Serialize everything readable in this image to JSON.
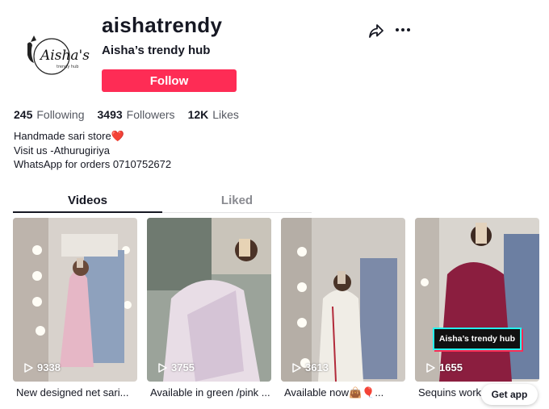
{
  "profile": {
    "username": "aishatrendy",
    "display_name": "Aisha’s trendy hub",
    "follow_label": "Follow",
    "avatar_text": "Aisha's"
  },
  "stats": {
    "following_count": "245",
    "following_label": "Following",
    "followers_count": "3493",
    "followers_label": "Followers",
    "likes_count": "12K",
    "likes_label": "Likes"
  },
  "bio": {
    "line1": "Handmade sari store❤️",
    "line2": "Visit us -Athurugiriya",
    "line3": "WhatsApp for orders 0710752672"
  },
  "tabs": [
    {
      "label": "Videos",
      "active": true
    },
    {
      "label": "Liked",
      "active": false
    }
  ],
  "videos": [
    {
      "views": "9338",
      "caption": "New designed net sari..."
    },
    {
      "views": "3755",
      "caption": "Available in green /pink ..."
    },
    {
      "views": "3613",
      "caption": "Available now👜🎈..."
    },
    {
      "views": "1655",
      "caption": "Sequins work",
      "overlay": "Aisha’s trendy hub"
    }
  ],
  "get_app_label": "Get app",
  "colors": {
    "accent": "#fe2c55",
    "text": "#161823",
    "muted": "#8a8b91",
    "cyan": "#25f4ee"
  },
  "icons": [
    "share-icon",
    "more-icon",
    "play-icon"
  ]
}
